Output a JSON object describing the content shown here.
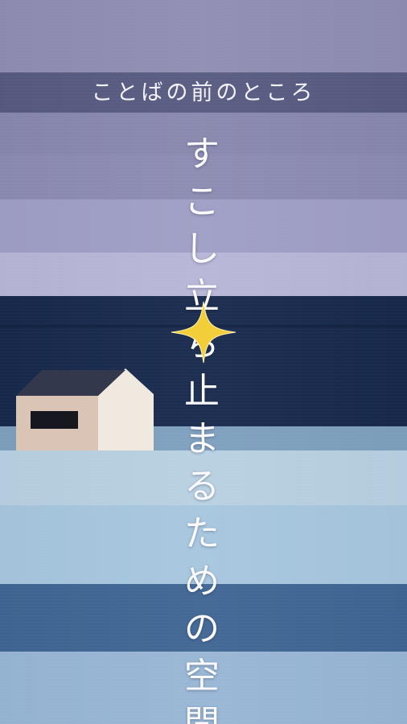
{
  "subtitle": "ことばの前のところ",
  "title_chars": [
    "す",
    "こ",
    "し",
    "立",
    "ち",
    "止",
    "ま",
    "る",
    "た",
    "め",
    "の",
    "空",
    "間"
  ],
  "icons": {
    "house": "house-illustration",
    "sparkle": "four-point-star-sparkle"
  },
  "colors": {
    "lavender": "#8e8db2",
    "dark_band": "#575a80",
    "night_navy": "#17294c",
    "light_blue": "#b7d0e1",
    "mid_blue": "#3f6593",
    "sparkle_gold": "#f2cf3a",
    "house_wall": "#d9c4b6",
    "house_side": "#efe9df",
    "house_roof": "#33384d"
  }
}
